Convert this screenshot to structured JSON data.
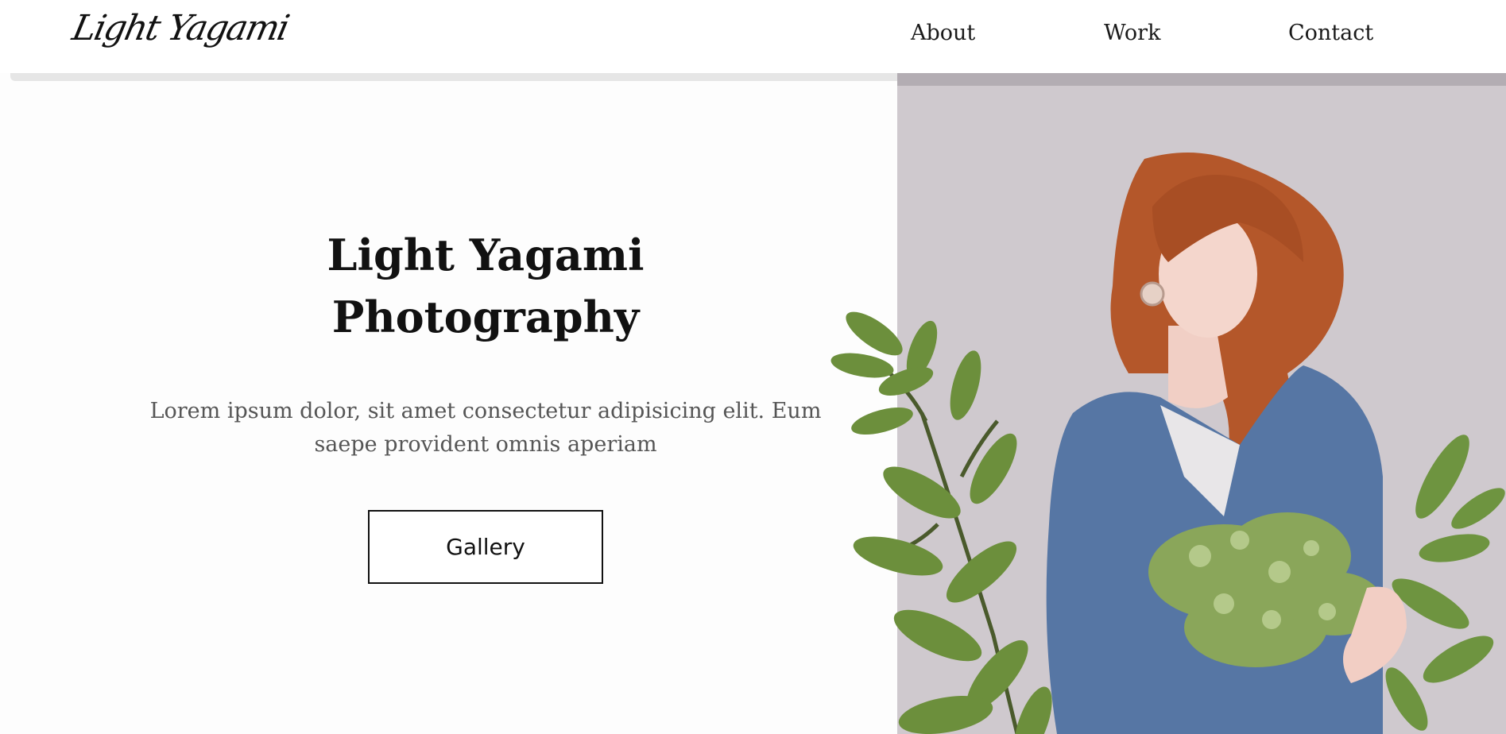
{
  "header": {
    "logo": "Light Yagami",
    "nav": [
      {
        "label": "About"
      },
      {
        "label": "Work"
      },
      {
        "label": "Contact"
      }
    ]
  },
  "hero": {
    "title_line1": "Light Yagami",
    "title_line2": "Photography",
    "description_line1": "Lorem ipsum dolor, sit amet consectetur adipisicing elit. Eum",
    "description_line2": "saepe provident omnis aperiam",
    "button_label": "Gallery"
  },
  "colors": {
    "background": "#fdfdfd",
    "photo_backdrop": "#cfc9ce",
    "text": "#111111",
    "muted_text": "#555555"
  }
}
